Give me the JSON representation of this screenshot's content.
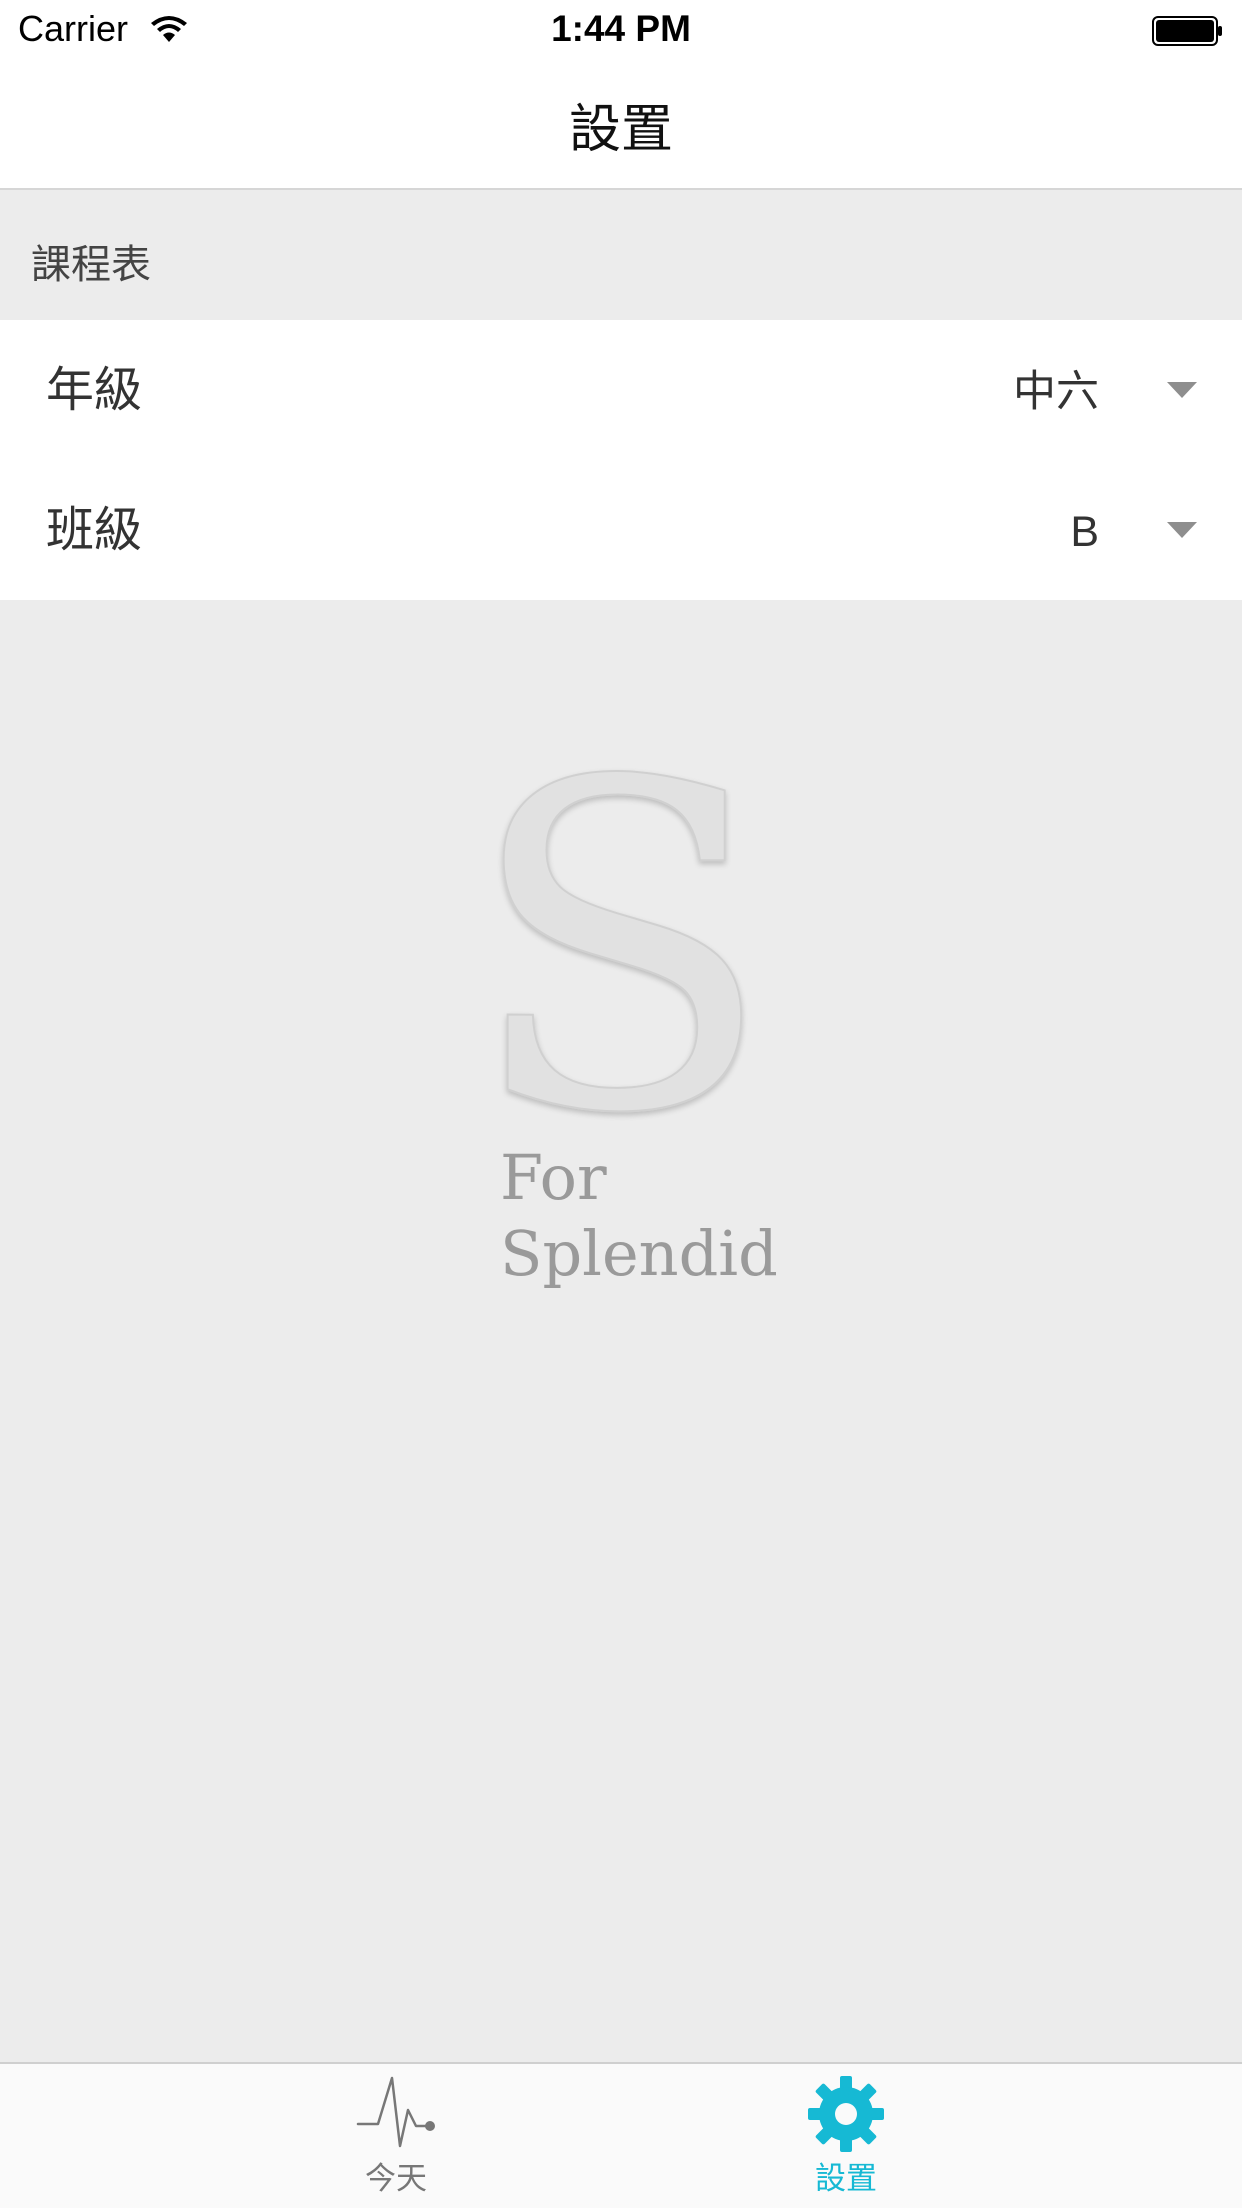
{
  "status_bar": {
    "carrier": "Carrier",
    "time": "1:44 PM"
  },
  "nav": {
    "title": "設置"
  },
  "section": {
    "header": "課程表"
  },
  "rows": [
    {
      "label": "年級",
      "value": "中六"
    },
    {
      "label": "班級",
      "value": "B"
    }
  ],
  "logo": {
    "line1": "For",
    "line2": "Splendid"
  },
  "tabs": [
    {
      "label": "今天",
      "icon": "pulse-icon",
      "active": false
    },
    {
      "label": "設置",
      "icon": "gear-icon",
      "active": true
    }
  ],
  "colors": {
    "accent": "#16b9d4",
    "background": "#ececec",
    "inactive_tab": "#777777"
  }
}
